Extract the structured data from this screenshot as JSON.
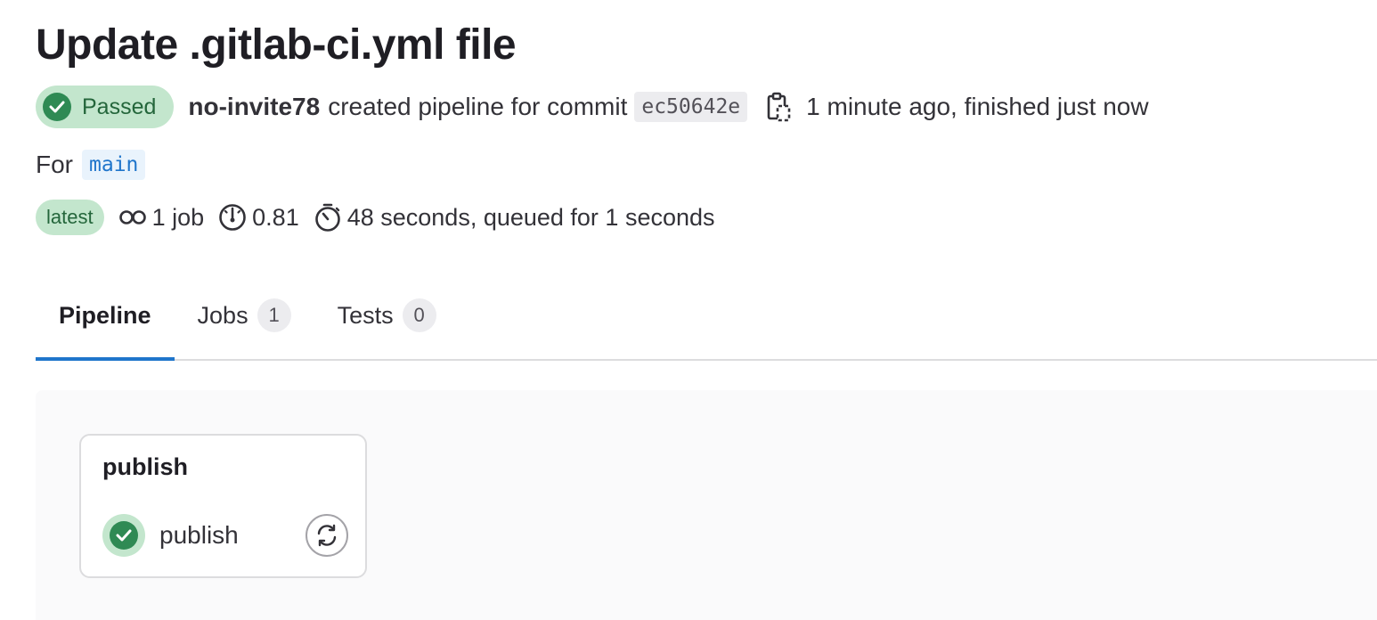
{
  "pipeline": {
    "title": "Update .gitlab-ci.yml file",
    "status": {
      "label": "Passed",
      "color": "#2f8a54",
      "icon": "check-circle-icon"
    },
    "author": "no-invite78",
    "action_text": "created pipeline for commit",
    "commit_sha": "ec50642e",
    "time_text": "1 minute ago, finished just now",
    "ref_prefix": "For",
    "ref_name": "main",
    "badges": [
      "latest"
    ],
    "jobs_count": "1 job",
    "coverage": "0.81",
    "duration_text": "48 seconds, queued for 1 seconds"
  },
  "tabs": [
    {
      "label": "Pipeline",
      "active": true
    },
    {
      "label": "Jobs",
      "count": "1"
    },
    {
      "label": "Tests",
      "count": "0"
    }
  ],
  "graph": {
    "stages": [
      {
        "name": "publish",
        "jobs": [
          {
            "name": "publish",
            "status": "passed",
            "action": "retry",
            "action_icon": "retry-icon"
          }
        ]
      }
    ]
  },
  "colors": {
    "accent": "#1f75cb",
    "success": "#2f8a54",
    "success_bg": "#c3e6cd"
  }
}
